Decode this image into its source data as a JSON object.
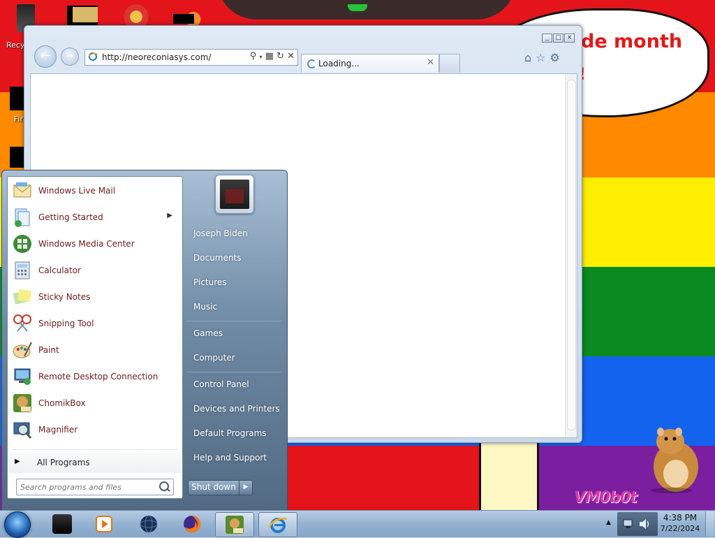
{
  "desktop": {
    "recycle_label": "Recy",
    "fi_label": "Fir",
    "bubble_text": "de month",
    "bubble_text2": "!",
    "watermark": "VM0b0t"
  },
  "browser": {
    "url": "http://neoreconiasys.com/",
    "tab_title": "Loading...",
    "caption_buttons": [
      "_",
      "□",
      "×"
    ],
    "toolbar_icons": [
      "home-icon",
      "star-icon",
      "gear-icon"
    ]
  },
  "start_menu": {
    "programs": [
      {
        "label": "Windows Live Mail",
        "icon": "mail-icon",
        "has_submenu": false
      },
      {
        "label": "Getting Started",
        "icon": "getting-started-icon",
        "has_submenu": true
      },
      {
        "label": "Windows Media Center",
        "icon": "media-center-icon",
        "has_submenu": false
      },
      {
        "label": "Calculator",
        "icon": "calculator-icon",
        "has_submenu": false
      },
      {
        "label": "Sticky Notes",
        "icon": "sticky-notes-icon",
        "has_submenu": false
      },
      {
        "label": "Snipping Tool",
        "icon": "snipping-tool-icon",
        "has_submenu": false
      },
      {
        "label": "Paint",
        "icon": "paint-icon",
        "has_submenu": false
      },
      {
        "label": "Remote Desktop Connection",
        "icon": "remote-desktop-icon",
        "has_submenu": false
      },
      {
        "label": "ChomikBox",
        "icon": "chomikbox-icon",
        "has_submenu": false
      },
      {
        "label": "Magnifier",
        "icon": "magnifier-icon",
        "has_submenu": false
      }
    ],
    "all_programs": "All Programs",
    "search_placeholder": "Search programs and files",
    "right_links": [
      "Joseph Biden",
      "Documents",
      "Pictures",
      "Music",
      "Games",
      "Computer",
      "Control Panel",
      "Devices and Printers",
      "Default Programs",
      "Help and Support"
    ],
    "shutdown": "Shut down"
  },
  "taskbar": {
    "apps": [
      "media-player-icon",
      "firefox-icon",
      "chomikbox-icon",
      "internet-explorer-icon"
    ],
    "time": "4:38 PM",
    "date": "7/22/2024"
  },
  "colors": {
    "link_text": "#6b1b1b",
    "accent": "#1b5bb0"
  }
}
